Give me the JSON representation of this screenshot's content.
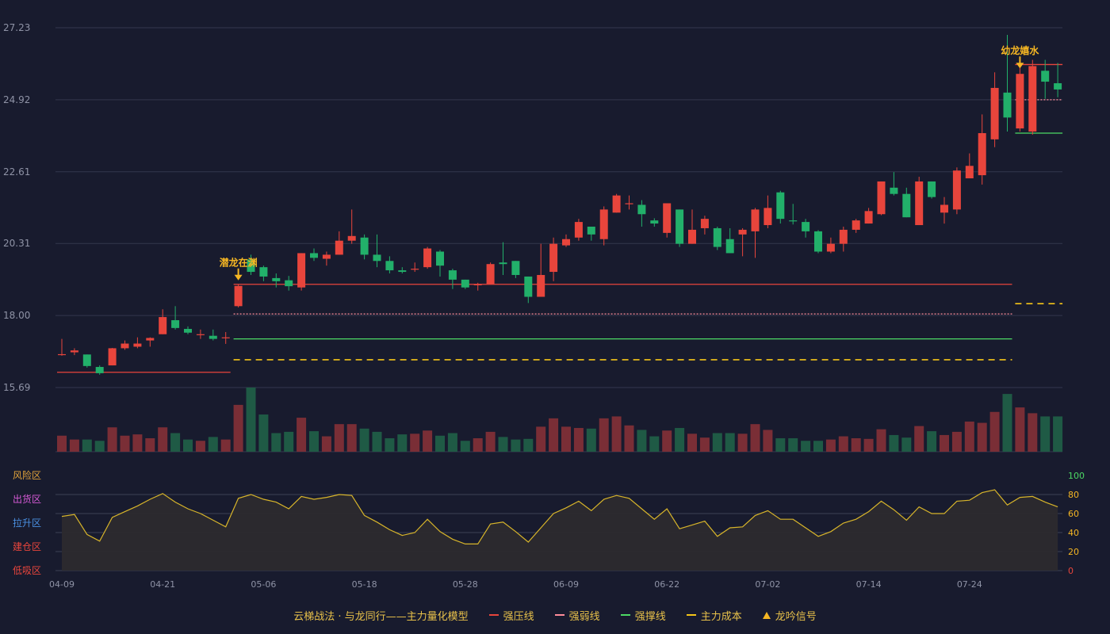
{
  "colors": {
    "background": "#181b2e",
    "up": "#e8453c",
    "down": "#22b06a",
    "grid": "#33374d",
    "axis_text": "#8f93a6",
    "pressure": "#e8453c",
    "weak": "#ff8c9a",
    "support": "#4cd964",
    "cost": "#f5c518",
    "signal": "#f5b623",
    "osc_line": "#d8b52a",
    "osc_fill": "#2c2a2e"
  },
  "legend": {
    "title": "云梯战法 · 与龙同行——主力量化模型",
    "items": [
      {
        "label": "强压线",
        "color": "#e8453c",
        "style": "solid"
      },
      {
        "label": "强弱线",
        "color": "#ff8c9a",
        "style": "dash"
      },
      {
        "label": "强撑线",
        "color": "#4cd964",
        "style": "solid"
      },
      {
        "label": "主力成本",
        "color": "#f5c518",
        "style": "dash"
      },
      {
        "label": "龙吟信号",
        "color": "#f5b623",
        "style": "triangle"
      }
    ]
  },
  "chart_data": {
    "type": "candlestick",
    "price_axis": {
      "ticks": [
        "27.23",
        "24.92",
        "22.61",
        "20.31",
        "18.00",
        "15.69"
      ],
      "range": [
        15.69,
        27.23
      ]
    },
    "zone_labels": [
      {
        "label": "风险区",
        "color": "#e0a23a"
      },
      {
        "label": "出货区",
        "color": "#d65ad6"
      },
      {
        "label": "拉升区",
        "color": "#4a8fe0"
      },
      {
        "label": "建仓区",
        "color": "#e8453c"
      },
      {
        "label": "低吸区",
        "color": "#e8453c"
      }
    ],
    "osc_axis": {
      "ticks": [
        "100",
        "80",
        "60",
        "40",
        "20",
        "0"
      ],
      "tick_colors": [
        "#4cd964",
        "#f5b623",
        "#f5b623",
        "#f5b623",
        "#f5b623",
        "#e8453c"
      ],
      "range": [
        0,
        100
      ]
    },
    "date_ticks": [
      {
        "index": 0,
        "label": "04-09"
      },
      {
        "index": 8,
        "label": "04-21"
      },
      {
        "index": 16,
        "label": "05-06"
      },
      {
        "index": 24,
        "label": "05-18"
      },
      {
        "index": 32,
        "label": "05-28"
      },
      {
        "index": 40,
        "label": "06-09"
      },
      {
        "index": 48,
        "label": "06-22"
      },
      {
        "index": 56,
        "label": "07-02"
      },
      {
        "index": 64,
        "label": "07-14"
      },
      {
        "index": 72,
        "label": "07-24"
      }
    ],
    "ohlc": [
      [
        16.75,
        16.76,
        17.25,
        16.71
      ],
      [
        16.82,
        16.88,
        16.95,
        16.73
      ],
      [
        16.75,
        16.38,
        16.75,
        16.33
      ],
      [
        16.35,
        16.15,
        16.4,
        16.1
      ],
      [
        16.4,
        16.95,
        16.96,
        16.4
      ],
      [
        16.95,
        17.1,
        17.2,
        16.9
      ],
      [
        17.0,
        17.1,
        17.3,
        16.95
      ],
      [
        17.2,
        17.28,
        17.3,
        17.0
      ],
      [
        17.4,
        17.95,
        18.2,
        17.4
      ],
      [
        17.85,
        17.6,
        18.3,
        17.55
      ],
      [
        17.57,
        17.45,
        17.65,
        17.4
      ],
      [
        17.4,
        17.4,
        17.55,
        17.25
      ],
      [
        17.35,
        17.25,
        17.55,
        17.2
      ],
      [
        17.27,
        17.3,
        17.47,
        17.09
      ],
      [
        18.3,
        18.95,
        19.0,
        18.26
      ],
      [
        19.8,
        19.4,
        19.95,
        19.3
      ],
      [
        19.55,
        19.25,
        19.6,
        19.1
      ],
      [
        19.2,
        19.1,
        19.35,
        18.9
      ],
      [
        19.13,
        18.94,
        19.27,
        18.8
      ],
      [
        18.9,
        20.0,
        20.0,
        18.8
      ],
      [
        20.0,
        19.85,
        20.15,
        19.75
      ],
      [
        19.82,
        19.95,
        20.05,
        19.6
      ],
      [
        19.95,
        20.4,
        20.7,
        19.95
      ],
      [
        20.4,
        20.55,
        21.4,
        20.3
      ],
      [
        20.5,
        19.95,
        20.6,
        19.8
      ],
      [
        19.95,
        19.75,
        20.6,
        19.55
      ],
      [
        19.75,
        19.45,
        19.9,
        19.35
      ],
      [
        19.45,
        19.4,
        19.55,
        19.35
      ],
      [
        19.5,
        19.5,
        19.7,
        19.4
      ],
      [
        19.55,
        20.15,
        20.2,
        19.5
      ],
      [
        20.05,
        19.6,
        20.1,
        19.25
      ],
      [
        19.45,
        19.15,
        19.5,
        18.85
      ],
      [
        19.15,
        18.9,
        19.15,
        18.85
      ],
      [
        19.0,
        19.0,
        19.05,
        18.8
      ],
      [
        19.0,
        19.65,
        19.7,
        19.0
      ],
      [
        19.7,
        19.65,
        20.35,
        19.3
      ],
      [
        19.75,
        19.3,
        19.75,
        19.2
      ],
      [
        19.25,
        18.6,
        19.25,
        18.4
      ],
      [
        18.6,
        19.3,
        20.3,
        18.6
      ],
      [
        19.4,
        20.3,
        20.5,
        19.1
      ],
      [
        20.25,
        20.45,
        20.6,
        20.2
      ],
      [
        20.5,
        21.0,
        21.1,
        20.4
      ],
      [
        20.85,
        20.6,
        20.85,
        20.4
      ],
      [
        20.45,
        21.4,
        21.5,
        20.25
      ],
      [
        21.3,
        21.85,
        21.9,
        21.3
      ],
      [
        21.6,
        21.6,
        21.85,
        21.4
      ],
      [
        21.55,
        21.25,
        21.7,
        20.85
      ],
      [
        21.05,
        20.95,
        21.12,
        20.85
      ],
      [
        20.65,
        21.6,
        21.6,
        20.5
      ],
      [
        21.4,
        20.3,
        21.4,
        20.2
      ],
      [
        20.3,
        20.75,
        21.4,
        20.3
      ],
      [
        20.8,
        21.1,
        21.2,
        20.6
      ],
      [
        20.8,
        20.2,
        20.85,
        20.1
      ],
      [
        20.45,
        20.0,
        20.8,
        20.0
      ],
      [
        20.6,
        20.75,
        20.8,
        19.9
      ],
      [
        20.7,
        21.4,
        21.45,
        19.85
      ],
      [
        20.9,
        21.45,
        21.85,
        20.8
      ],
      [
        21.95,
        21.1,
        22.0,
        20.95
      ],
      [
        21.05,
        21.02,
        21.58,
        20.92
      ],
      [
        21.0,
        20.7,
        21.1,
        20.5
      ],
      [
        20.7,
        20.05,
        20.74,
        20.0
      ],
      [
        20.05,
        20.3,
        20.5,
        20.0
      ],
      [
        20.3,
        20.75,
        20.85,
        20.05
      ],
      [
        20.75,
        21.05,
        21.1,
        20.65
      ],
      [
        20.95,
        21.35,
        21.45,
        20.95
      ],
      [
        21.25,
        22.3,
        22.3,
        21.22
      ],
      [
        22.1,
        21.9,
        22.6,
        21.85
      ],
      [
        21.9,
        21.15,
        22.1,
        21.15
      ],
      [
        20.9,
        22.3,
        22.45,
        20.9
      ],
      [
        22.3,
        21.8,
        22.3,
        21.75
      ],
      [
        21.3,
        21.55,
        21.8,
        20.95
      ],
      [
        21.4,
        22.65,
        22.75,
        21.25
      ],
      [
        22.4,
        22.8,
        23.2,
        22.4
      ],
      [
        22.5,
        23.85,
        24.45,
        22.2
      ],
      [
        23.65,
        25.3,
        25.8,
        23.4
      ],
      [
        25.15,
        24.35,
        27.0,
        23.9
      ],
      [
        24.0,
        25.75,
        25.95,
        23.9
      ],
      [
        23.9,
        26.0,
        26.2,
        23.8
      ],
      [
        25.85,
        25.5,
        26.2,
        24.95
      ],
      [
        25.45,
        25.25,
        26.1,
        25.0
      ]
    ],
    "volume": [
      0.25,
      0.19,
      0.19,
      0.17,
      0.38,
      0.25,
      0.27,
      0.21,
      0.38,
      0.29,
      0.19,
      0.17,
      0.23,
      0.19,
      0.73,
      1.0,
      0.58,
      0.29,
      0.31,
      0.53,
      0.32,
      0.24,
      0.43,
      0.43,
      0.36,
      0.31,
      0.21,
      0.27,
      0.28,
      0.33,
      0.25,
      0.29,
      0.17,
      0.21,
      0.31,
      0.23,
      0.19,
      0.2,
      0.39,
      0.52,
      0.39,
      0.37,
      0.36,
      0.52,
      0.55,
      0.41,
      0.34,
      0.24,
      0.33,
      0.37,
      0.28,
      0.22,
      0.29,
      0.29,
      0.28,
      0.43,
      0.34,
      0.21,
      0.21,
      0.17,
      0.17,
      0.19,
      0.24,
      0.21,
      0.2,
      0.35,
      0.26,
      0.22,
      0.4,
      0.32,
      0.26,
      0.31,
      0.47,
      0.45,
      0.62,
      0.9,
      0.69,
      0.6,
      0.55,
      0.55
    ],
    "oscillator": [
      57,
      59,
      38,
      31,
      56,
      62,
      68,
      75,
      81,
      72,
      65,
      60,
      53,
      46,
      76,
      80,
      75,
      72,
      65,
      78,
      75,
      77,
      80,
      79,
      58,
      51,
      43,
      37,
      40,
      54,
      41,
      33,
      28,
      28,
      49,
      51,
      41,
      30,
      45,
      60,
      66,
      73,
      63,
      75,
      79,
      76,
      65,
      54,
      65,
      44,
      48,
      52,
      36,
      45,
      46,
      58,
      63,
      54,
      54,
      45,
      36,
      41,
      50,
      54,
      62,
      73,
      64,
      53,
      67,
      60,
      60,
      73,
      74,
      82,
      85,
      69,
      77,
      78,
      72,
      67
    ],
    "pressure_lines": [
      {
        "from": 0,
        "to": 13,
        "value": 16.18
      },
      {
        "from": 14,
        "to": 75,
        "value": 19.0
      },
      {
        "from": 76,
        "to": 79,
        "value": 26.05
      }
    ],
    "weak_lines": [
      {
        "from": 14,
        "to": 75,
        "value": 18.05
      },
      {
        "from": 76,
        "to": 79,
        "value": 24.92
      }
    ],
    "support_lines": [
      {
        "from": 14,
        "to": 75,
        "value": 17.25
      },
      {
        "from": 76,
        "to": 79,
        "value": 23.85
      }
    ],
    "cost_lines": [
      {
        "from": 14,
        "to": 75,
        "value": 16.58
      },
      {
        "from": 76,
        "to": 79,
        "value": 18.38
      }
    ],
    "signals": [
      {
        "index": 14,
        "label": "潜龙在渊"
      },
      {
        "index": 76,
        "label": "幼龙嬉水"
      }
    ]
  }
}
